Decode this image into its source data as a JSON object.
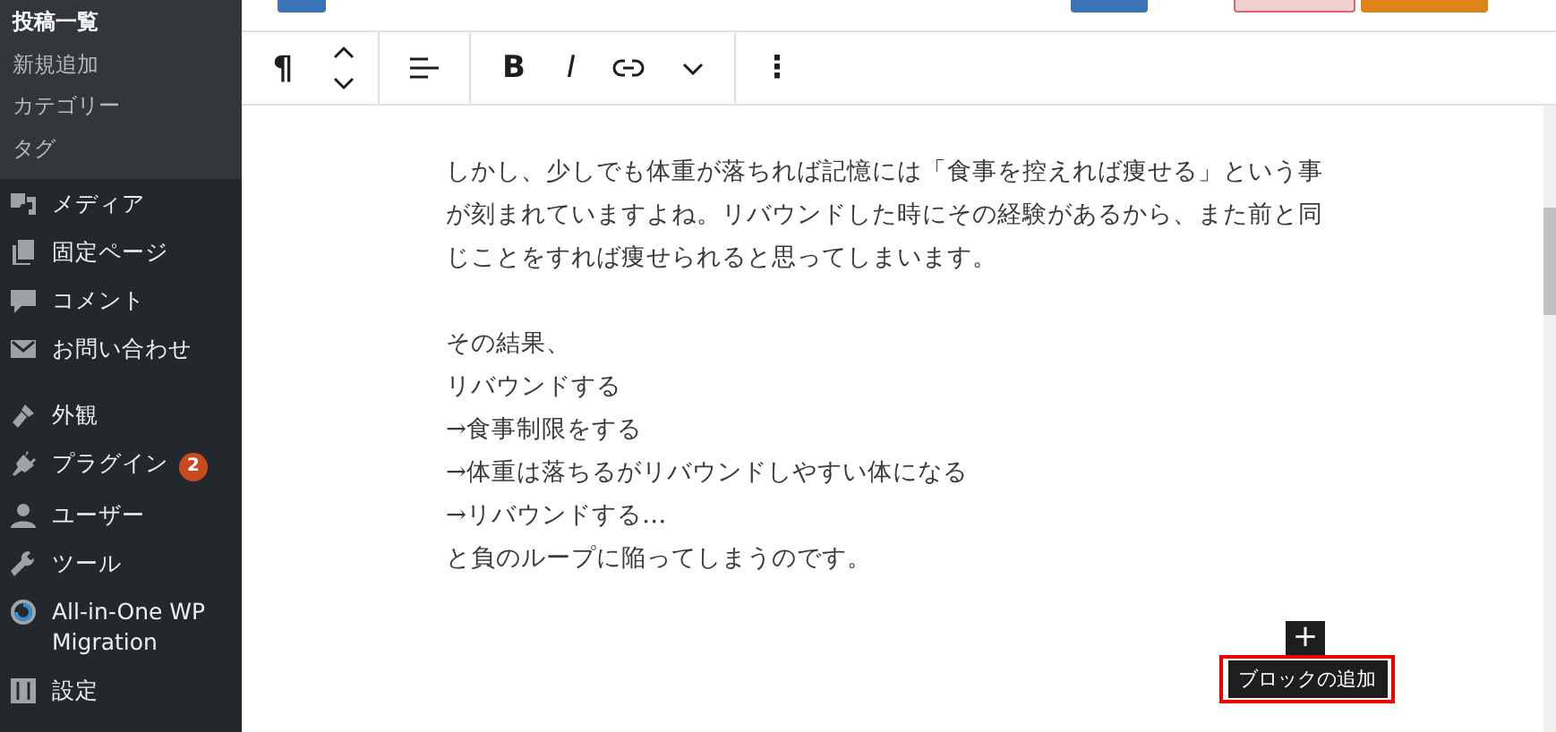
{
  "sidebar": {
    "submenu": [
      {
        "label": "投稿一覧",
        "selected": true
      },
      {
        "label": "新規追加",
        "selected": false
      },
      {
        "label": "カテゴリー",
        "selected": false
      },
      {
        "label": "タグ",
        "selected": false
      }
    ],
    "menu_groups": [
      [
        {
          "label": "メディア",
          "kind": "media"
        },
        {
          "label": "固定ページ",
          "kind": "pages"
        },
        {
          "label": "コメント",
          "kind": "comment"
        },
        {
          "label": "お問い合わせ",
          "kind": "mail"
        }
      ],
      [
        {
          "label": "外観",
          "kind": "brush"
        },
        {
          "label": "プラグイン",
          "kind": "plug",
          "badge": "2"
        },
        {
          "label": "ユーザー",
          "kind": "user"
        },
        {
          "label": "ツール",
          "kind": "wrench"
        },
        {
          "label": "All-in-One WP Migration",
          "kind": "ring"
        },
        {
          "label": "設定",
          "kind": "sliders"
        }
      ]
    ]
  },
  "toolbar": {
    "groups": [
      [
        {
          "kind": "paragraph",
          "label": "¶"
        },
        {
          "kind": "move"
        }
      ],
      [
        {
          "kind": "align"
        }
      ],
      [
        {
          "kind": "bold",
          "label": "B"
        },
        {
          "kind": "italic",
          "label": "I"
        },
        {
          "kind": "link"
        },
        {
          "kind": "caret"
        }
      ],
      [
        {
          "kind": "options",
          "label": "⋮"
        }
      ]
    ]
  },
  "content": {
    "paragraphs": [
      {
        "lines": [
          "しかし、少しでも体重が落ちれば記憶には「食事を控えれば痩せる」という事が刻まれていますよね。リバウンドした時にその経験があるから、また前と同じことをすれば痩せられると思ってしまいます。"
        ]
      },
      {
        "lines": [
          "その結果、",
          "リバウンドする",
          "→食事制限をする",
          "→体重は落ちるがリバウンドしやすい体になる",
          "→リバウンドする…",
          "と負のループに陥ってしまうのです。"
        ]
      }
    ],
    "add_block": {
      "icon": "+",
      "tooltip": "ブロックの追加",
      "highlighted": true
    }
  }
}
